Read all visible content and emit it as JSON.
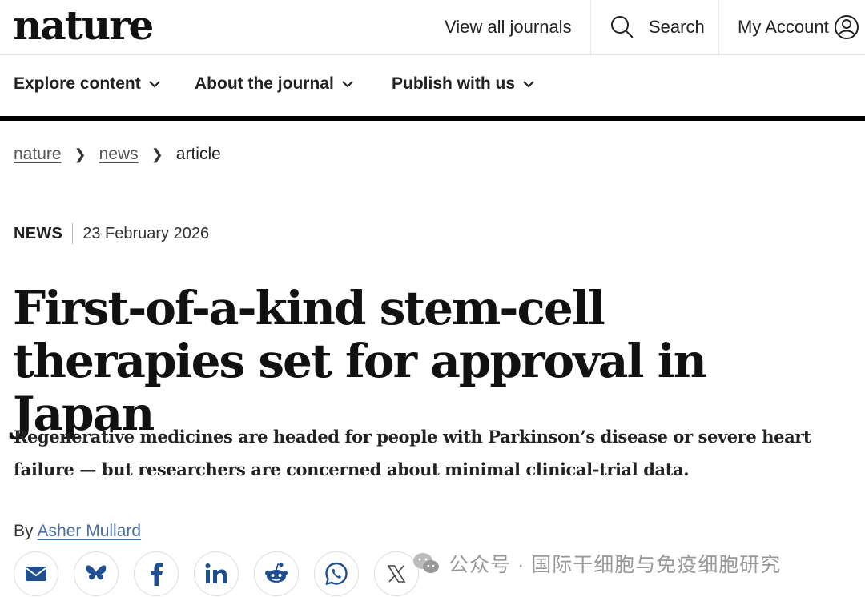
{
  "header": {
    "logo": "nature",
    "view_all_journals": "View all journals",
    "search_label": "Search",
    "account_label": "My Account"
  },
  "nav": {
    "items": [
      {
        "label": "Explore content"
      },
      {
        "label": "About the journal"
      },
      {
        "label": "Publish with us"
      }
    ]
  },
  "breadcrumb": {
    "items": [
      "nature",
      "news",
      "article"
    ]
  },
  "article": {
    "type": "NEWS",
    "date": "23 February 2026",
    "title": "First-of-a-kind stem-cell therapies set for approval in Japan",
    "standfirst": "Regenerative medicines are headed for people with Parkinson’s disease or severe heart failure — but researchers are concerned about minimal clinical-trial data.",
    "byline_prefix": "By",
    "author": "Asher Mullard"
  },
  "share": {
    "icons": [
      "email-icon",
      "bluesky-icon",
      "facebook-icon",
      "linkedin-icon",
      "reddit-icon",
      "whatsapp-icon",
      "x-icon"
    ]
  },
  "watermark": {
    "text": "公众号 · 国际干细胞与免疫细胞研究"
  },
  "colors": {
    "text": "#222222",
    "link": "#4a6fa5",
    "rule": "#000000",
    "share_icon": "#1f4f8f"
  }
}
